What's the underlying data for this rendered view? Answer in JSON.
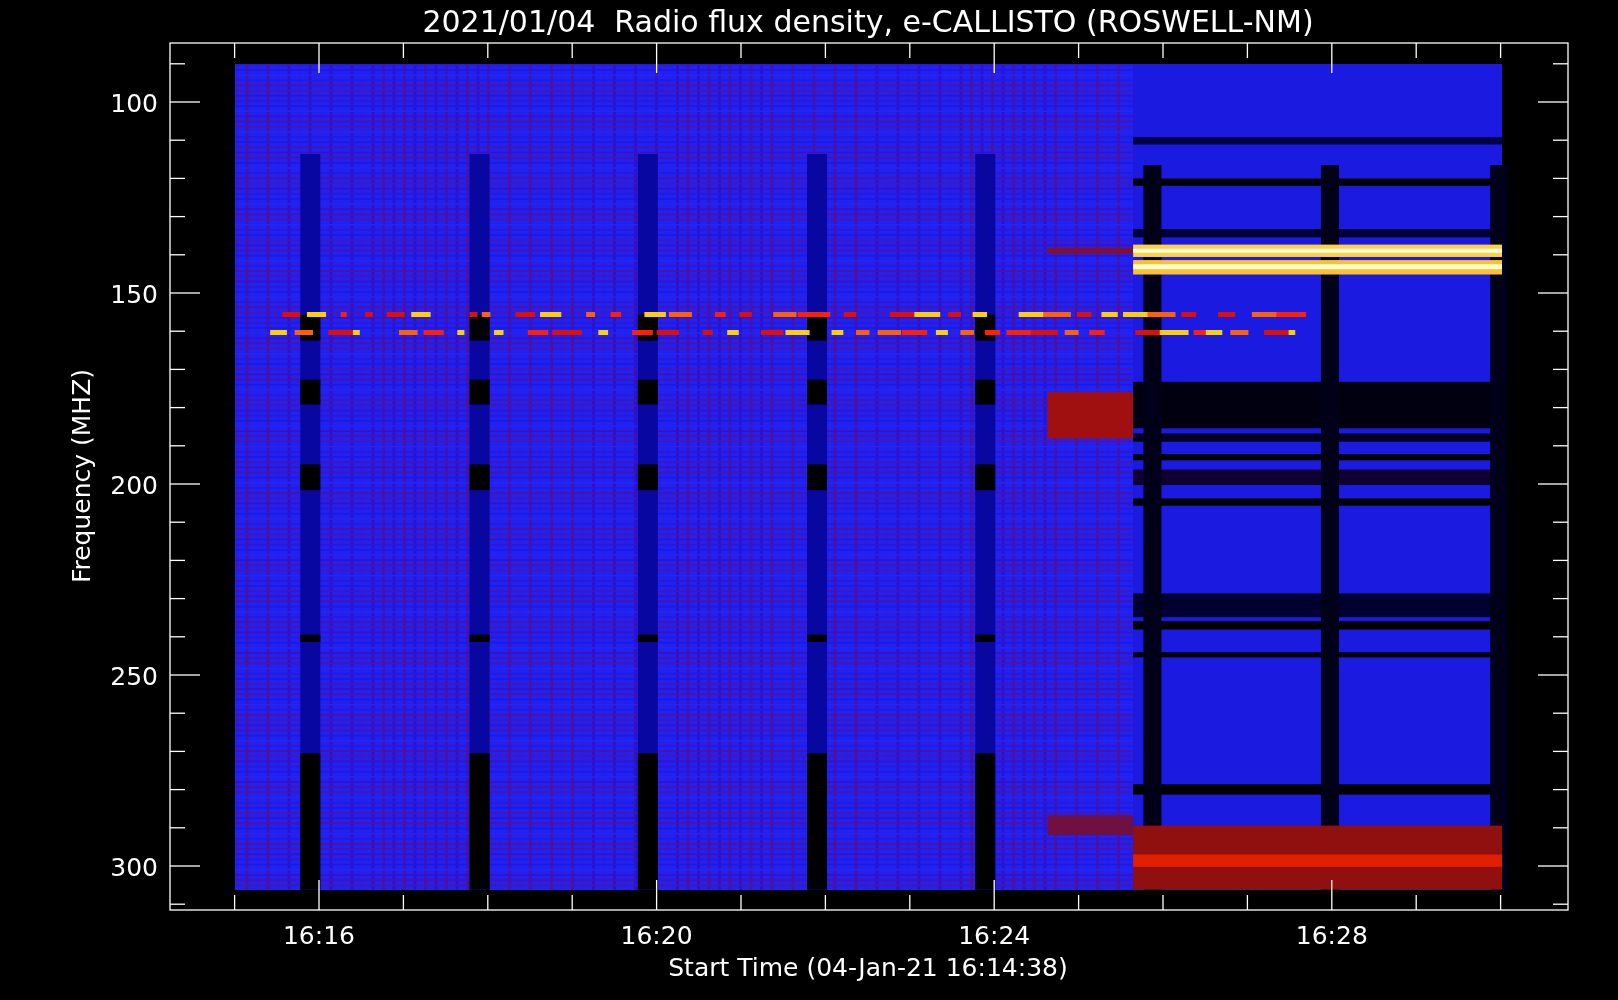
{
  "title": "2021/01/04  Radio flux density, e-CALLISTO (ROSWELL-NM)",
  "y_axis": {
    "label": "Frequency (MHZ)",
    "ticks": [
      "100",
      "150",
      "200",
      "250",
      "300"
    ]
  },
  "x_axis": {
    "label": "Start Time (04-Jan-21 16:14:38)",
    "ticks": [
      "16:16",
      "16:20",
      "16:24",
      "16:28"
    ]
  }
}
